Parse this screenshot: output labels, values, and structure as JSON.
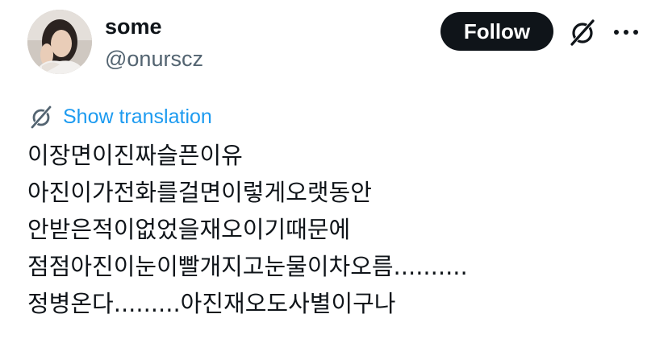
{
  "author": {
    "display_name": "some",
    "handle": "@onurscz"
  },
  "actions": {
    "follow_label": "Follow",
    "grok_icon": "grok-icon",
    "more_icon": "more-icon"
  },
  "translation": {
    "label": "Show translation",
    "icon": "grok-icon"
  },
  "post": {
    "lines": [
      "이장면이진짜슬픈이유",
      "아진이가전화를걸면이렇게오랫동안",
      "안받은적이없었을재오이기때문에",
      "점점아진이눈이빨개지고눈물이차오름..........",
      "정병온다.........아진재오도사별이구나"
    ]
  },
  "colors": {
    "text": "#0f1419",
    "secondary": "#536471",
    "link": "#1d9bf0",
    "button_bg": "#0f1419",
    "button_text": "#ffffff"
  }
}
